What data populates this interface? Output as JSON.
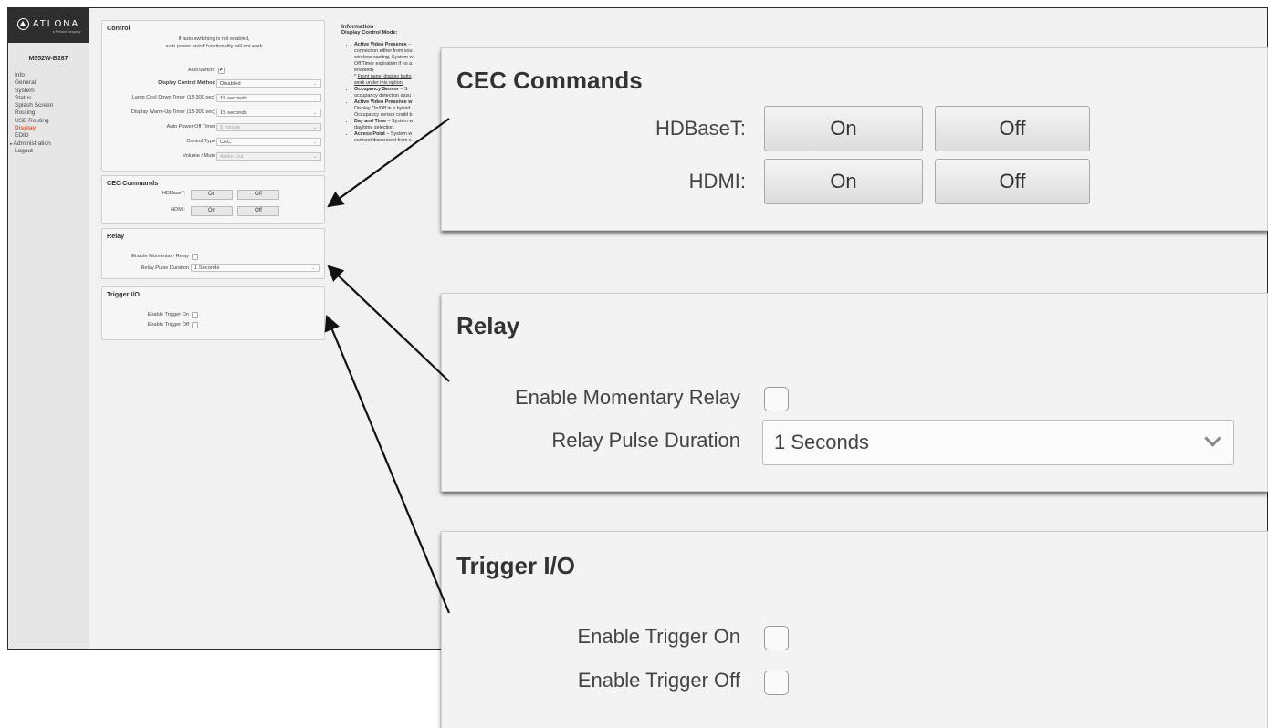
{
  "brand": {
    "name": "ATLONA",
    "tagline": "a Panduit company"
  },
  "device": {
    "model": "M552W-B287"
  },
  "sidebar": {
    "items": [
      {
        "label": "Info",
        "active": false
      },
      {
        "label": "General",
        "active": false
      },
      {
        "label": "System",
        "active": false
      },
      {
        "label": "Status",
        "active": false
      },
      {
        "label": "Splash Screen",
        "active": false
      },
      {
        "label": "Routing",
        "active": false
      },
      {
        "label": "USB Routing",
        "active": false
      },
      {
        "label": "Display",
        "active": true
      },
      {
        "label": "EDID",
        "active": false
      },
      {
        "label": "Administration",
        "active": false
      },
      {
        "label": "Logout",
        "active": false
      }
    ]
  },
  "control": {
    "title": "Control",
    "notice_line1": "If auto switching is not enabled,",
    "notice_line2": "auto power on/off functionality will not work",
    "autoswitch_label": "AutoSwitch",
    "autoswitch_checked": true,
    "display_control_method_label": "Display Control Method",
    "display_control_method_value": "Disabled",
    "lamp_cool_down_label": "Lamp Cool Down Timer (15-300 sec)",
    "lamp_cool_down_value": "15 seconds",
    "warm_up_label": "Display Warm-Up Timer (15-300 sec)",
    "warm_up_value": "15 seconds",
    "auto_power_off_label": "Auto Power Off Timer",
    "auto_power_off_value": "5 minute",
    "control_type_label": "Control Type",
    "control_type_value": "CEC",
    "volume_mute_label": "Volume / Mute",
    "volume_mute_value": "Audio Out"
  },
  "cec": {
    "title": "CEC Commands",
    "hdbaset_label": "HDBaseT:",
    "hdmi_label": "HDMI:",
    "on_label": "On",
    "off_label": "Off"
  },
  "relay": {
    "title": "Relay",
    "momentary_label": "Enable Momentary Relay",
    "momentary_checked": false,
    "pulse_label": "Relay Pulse Duration",
    "pulse_value": "1 Seconds"
  },
  "trigger": {
    "title": "Trigger I/O",
    "on_label": "Enable Trigger On",
    "on_checked": false,
    "off_label": "Enable Trigger Off",
    "off_checked": false
  },
  "information": {
    "title": "Information",
    "subtitle": "Display Control Mode:",
    "items": [
      {
        "head": "Active Video Presence",
        "text": " –\nconnection either from sou\nwireless casting. System w\nOff Timer expiration if no a\nenabled).\n* ",
        "link": "Front panel display butto\nwork under this option."
      },
      {
        "head": "Occupancy Sensor",
        "text": " – S\noccupancy detection assu",
        "link": ""
      },
      {
        "head": "Active Video Presence w",
        "text": "\nDisplay On/Off in a hybrid\nOccupancy sensor could b",
        "link": ""
      },
      {
        "head": "Day and Time",
        "text": " – System w\nday/time selection.",
        "link": ""
      },
      {
        "head": "Access Point",
        "text": " – System w\nconnect/disconnect from s",
        "link": ""
      }
    ]
  },
  "colors": {
    "accent": "#e85b1a",
    "sidebar_bg": "#e6e6e6",
    "logo_bg": "#2e2e2e"
  }
}
